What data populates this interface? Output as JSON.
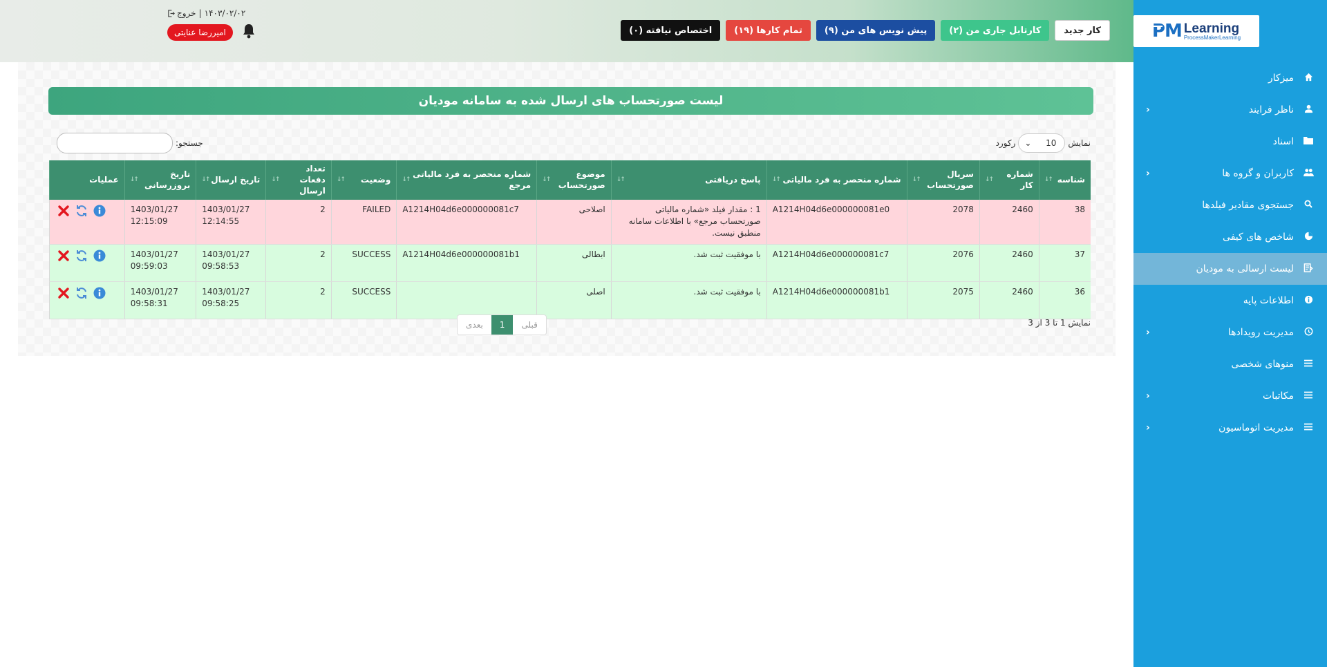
{
  "brand": {
    "pm": "PM",
    "learning": "Learning",
    "sub": "ProcessMakerLearning"
  },
  "sidebar": {
    "items": [
      {
        "label": "میزکار",
        "icon": "home-icon",
        "has_children": false,
        "active": false
      },
      {
        "label": "ناظر فرایند",
        "icon": "user-icon",
        "has_children": true,
        "active": false
      },
      {
        "label": "اسناد",
        "icon": "folder-icon",
        "has_children": false,
        "active": false
      },
      {
        "label": "کاربران و گروه ها",
        "icon": "users-icon",
        "has_children": true,
        "active": false
      },
      {
        "label": "جستجوی مقادیر فیلدها",
        "icon": "search-icon",
        "has_children": false,
        "active": false
      },
      {
        "label": "شاخص های کیفی",
        "icon": "pie-chart-icon",
        "has_children": false,
        "active": false
      },
      {
        "label": "لیست ارسالی به مودیان",
        "icon": "send-list-icon",
        "has_children": false,
        "active": true
      },
      {
        "label": "اطلاعات پایه",
        "icon": "info-icon",
        "has_children": false,
        "active": false
      },
      {
        "label": "مدیریت رویدادها",
        "icon": "history-icon",
        "has_children": true,
        "active": false
      },
      {
        "label": "منوهای شخصی",
        "icon": "list-icon",
        "has_children": false,
        "active": false
      },
      {
        "label": "مکاتبات",
        "icon": "list-icon",
        "has_children": true,
        "active": false
      },
      {
        "label": "مدیریت اتوماسیون",
        "icon": "list-icon",
        "has_children": true,
        "active": false
      }
    ]
  },
  "header": {
    "buttons": {
      "new_task": "کار جدید",
      "my_inbox": "کارتابل جاری من (۲)",
      "my_drafts": "پیش نویس های من (۹)",
      "all_tasks": "تمام کارها (۱۹)",
      "unassigned": "اختصاص نیافته (۰)"
    },
    "date": "۱۴۰۳/۰۲/۰۲",
    "separator": "|",
    "logout": "خروج",
    "user_name": "امیررضا عنایتی"
  },
  "page": {
    "title": "لیست صورتحساب های ارسال شده به سامانه مودیان",
    "length_prefix": "نمایش",
    "length_value": "10",
    "length_suffix": "رکورد",
    "search_label": "جستجو:",
    "search_value": "",
    "info": "نمایش 1 تا 3 از 3",
    "pager": {
      "prev": "قبلی",
      "current": "1",
      "next": "بعدی"
    }
  },
  "table": {
    "headers": [
      "شناسه",
      "شماره کار",
      "سریال صورتحساب",
      "شماره منحصر به فرد مالیاتی",
      "پاسخ دریافتی",
      "موضوع صورتحساب",
      "شماره منحصر به فرد مالیاتی مرجع",
      "وضعیت",
      "تعداد دفعات ارسال",
      "تاریخ ارسال",
      "تاریخ بروزرسانی",
      "عملیات"
    ],
    "rows": [
      {
        "status_class": "failed",
        "id": "38",
        "task_no": "2460",
        "serial": "2078",
        "tax_id": "A1214H04d6e000000081e0",
        "response": "1 : مقدار فیلد «شماره مالیاتی صورتحساب مرجع» با اطلاعات سامانه منطبق نیست.",
        "subject": "اصلاحی",
        "ref_tax_id": "A1214H04d6e000000081c7",
        "status": "FAILED",
        "send_count": "2",
        "send_date": "1403/01/27",
        "send_time": "12:14:55",
        "update_date": "1403/01/27",
        "update_time": "12:15:09"
      },
      {
        "status_class": "success",
        "id": "37",
        "task_no": "2460",
        "serial": "2076",
        "tax_id": "A1214H04d6e000000081c7",
        "response": "با موفقیت ثبت شد.",
        "subject": "ابطالی",
        "ref_tax_id": "A1214H04d6e000000081b1",
        "status": "SUCCESS",
        "send_count": "2",
        "send_date": "1403/01/27",
        "send_time": "09:58:53",
        "update_date": "1403/01/27",
        "update_time": "09:59:03"
      },
      {
        "status_class": "success",
        "id": "36",
        "task_no": "2460",
        "serial": "2075",
        "tax_id": "A1214H04d6e000000081b1",
        "response": "با موفقیت ثبت شد.",
        "subject": "اصلی",
        "ref_tax_id": "",
        "status": "SUCCESS",
        "send_count": "2",
        "send_date": "1403/01/27",
        "send_time": "09:58:25",
        "update_date": "1403/01/27",
        "update_time": "09:58:31"
      }
    ]
  },
  "colors": {
    "sidebar": "#1b9fdd",
    "table_header": "#3d8f6f",
    "failed_row": "#ffd6dc",
    "success_row": "#d8fcdf"
  }
}
